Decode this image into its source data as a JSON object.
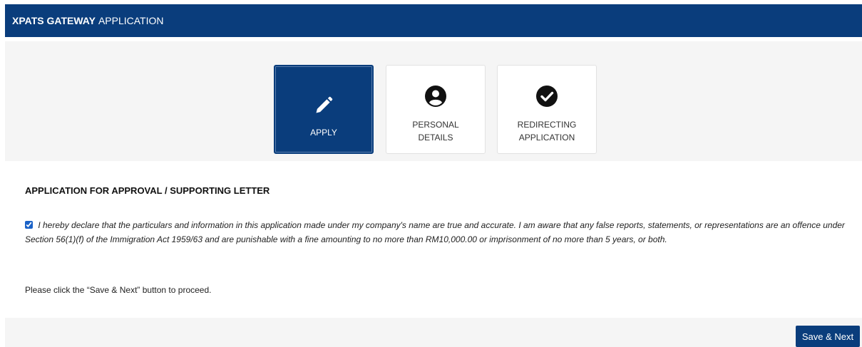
{
  "header": {
    "title_bold": "XPATS GATEWAY",
    "title_rest": "APPLICATION"
  },
  "steps": [
    {
      "label": "APPLY",
      "icon": "pencil-icon",
      "active": true
    },
    {
      "label_line1": "PERSONAL",
      "label_line2": "DETAILS",
      "icon": "user-circle-icon",
      "active": false
    },
    {
      "label_line1": "REDIRECTING",
      "label_line2": "APPLICATION",
      "icon": "check-circle-icon",
      "active": false
    }
  ],
  "section": {
    "title": "APPLICATION FOR APPROVAL / SUPPORTING LETTER"
  },
  "declaration": {
    "checked": true,
    "text": "I hereby declare that the particulars and information in this application made under my company's name are true and accurate. I am aware that any false reports, statements, or representations are an offence under Section 56(1)(f) of the Immigration Act 1959/63 and are punishable with a fine amounting to no more than RM10,000.00 or imprisonment of no more than 5 years, or both."
  },
  "instruction": "Please click the “Save & Next” button to proceed.",
  "actions": {
    "save_next_label": "Save & Next"
  },
  "colors": {
    "primary": "#0a3d7c",
    "panel": "#f5f5f5"
  }
}
